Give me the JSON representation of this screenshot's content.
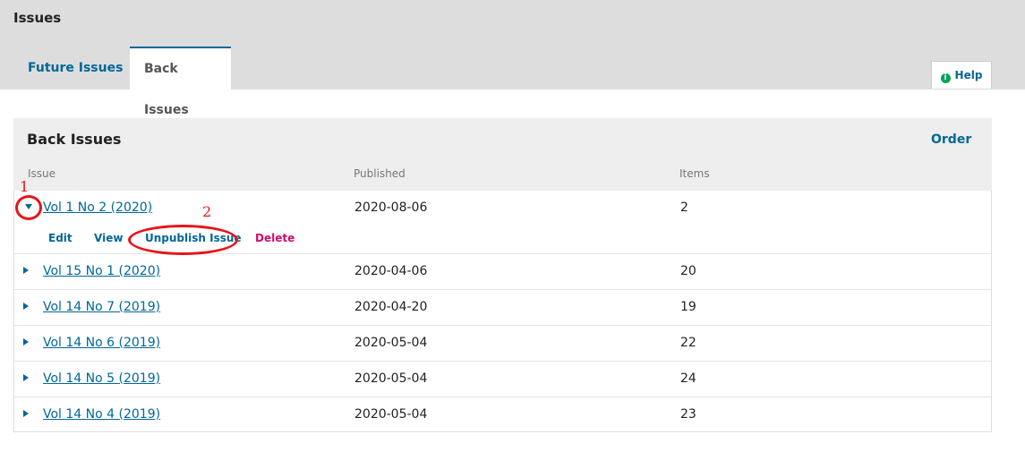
{
  "header": {
    "title": "Issues",
    "tabs": [
      {
        "label": "Future Issues"
      },
      {
        "label": "Back Issues",
        "active": true
      }
    ],
    "help_label": "Help",
    "help_icon": "info-icon"
  },
  "panel": {
    "title": "Back Issues",
    "order_label": "Order",
    "columns": [
      "Issue",
      "Published",
      "Items"
    ]
  },
  "expanded_row": {
    "issue": "Vol 1 No 2 (2020)",
    "published": "2020-08-06",
    "items": "2",
    "actions": {
      "edit": "Edit",
      "view": "View",
      "unpublish": "Unpublish Issue",
      "delete": "Delete"
    }
  },
  "rows": [
    {
      "issue": "Vol 15 No 1 (2020)",
      "published": "2020-04-06",
      "items": "20"
    },
    {
      "issue": "Vol 14 No 7 (2019)",
      "published": "2020-04-20",
      "items": "19"
    },
    {
      "issue": "Vol 14 No 6 (2019)",
      "published": "2020-05-04",
      "items": "22"
    },
    {
      "issue": "Vol 14 No 5 (2019)",
      "published": "2020-05-04",
      "items": "24"
    },
    {
      "issue": "Vol 14 No 4 (2019)",
      "published": "2020-05-04",
      "items": "23"
    }
  ],
  "annotations": {
    "marker_1": "1",
    "marker_2": "2",
    "color": "#e8141a"
  },
  "colors": {
    "accent": "#006798",
    "delete": "#d00a6c",
    "header_bg": "#dddddd"
  }
}
